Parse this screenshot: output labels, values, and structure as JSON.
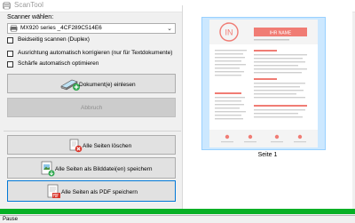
{
  "window": {
    "title": "ScanTool"
  },
  "scanner": {
    "label": "Scanner wählen:",
    "selected": "MX920 series _4CF289C514E6"
  },
  "options": [
    {
      "label": "Beidseitig scannen (Duplex)",
      "checked": false
    },
    {
      "label": "Ausrichtung automatisch korrigieren (nur für Textdokumente)",
      "checked": false
    },
    {
      "label": "Schärfe automatisch optimieren",
      "checked": false
    }
  ],
  "buttons": {
    "scan": "Dokument(e) einlesen",
    "cancel": "Abbruch",
    "delete_all": "Alle Seiten löschen",
    "save_images": "Alle Seiten als Bilddatei(en) speichern",
    "save_pdf": "Alle Seiten als PDF speichern"
  },
  "preview": {
    "page_label": "Seite 1",
    "resume": {
      "initials": "IN",
      "name": "IHR NAME",
      "sections": [
        "ERFAHRUNG",
        "AUSBILDUNG",
        "QUALIFIKATIONEN",
        "EHRENAMTLICHE TÄTIGKEITEN UND AUSZEICHNUNGEN"
      ]
    }
  },
  "status": {
    "text": "Pause"
  },
  "colors": {
    "accent_pink": "#f07c74",
    "progress_green": "#06b025",
    "selection_blue": "#cce8ff"
  }
}
